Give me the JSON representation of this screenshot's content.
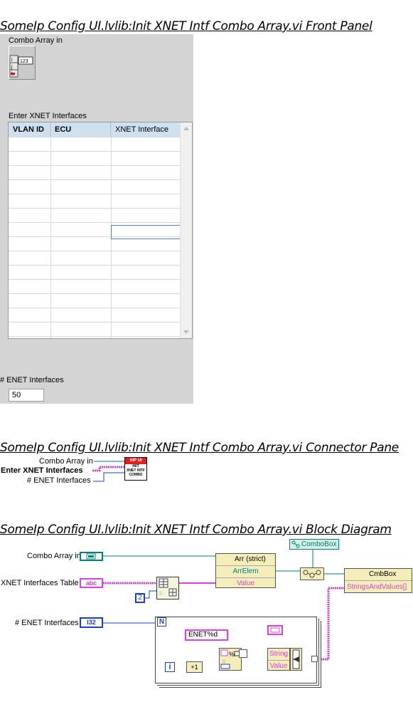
{
  "sections": {
    "front_panel_title": "SomeIp Config UI.lvlib:Init XNET Intf Combo Array.vi Front Panel",
    "connector_title": "SomeIp Config UI.lvlib:Init XNET Intf Combo Array.vi Connector Pane",
    "block_diagram_title": "SomeIp Config UI.lvlib:Init XNET Intf Combo Array.vi Block Diagram"
  },
  "front_panel": {
    "combo_array_label": "Combo Array in",
    "combo_array_icon_text": "123",
    "combo_array_index": "0",
    "table_label": "Enter XNET Interfaces",
    "table_headers": [
      "VLAN ID",
      "ECU",
      "XNET Interface"
    ],
    "enet_label": "# ENET Interfaces",
    "enet_value": "50"
  },
  "connector": {
    "labels": [
      "Combo Array in",
      "Enter XNET Interfaces",
      "# ENET Interfaces"
    ],
    "icon_banner": "SIP UI",
    "icon_lines": [
      "INIT",
      "XNET INTF",
      "COMBO"
    ]
  },
  "block_diagram": {
    "combo_array_label": "Combo Array in",
    "table_label": "XNET Interfaces Table",
    "table_terminal": "abc",
    "enet_label": "# ENET Interfaces",
    "enet_terminal": "I32",
    "const_2": "2",
    "loop_n": "N",
    "loop_i": "i",
    "format_string": "ENET%d",
    "combobox_ref": "ComboBox",
    "bundle_arr": "Arr (strict)",
    "bundle_arrelem": "ArrElem",
    "bundle_value": "Value",
    "cmbbox_node": "CmbBox",
    "cmbbox_prop": "StringsAndValues[]",
    "cluster_string": "String",
    "cluster_value": "Value",
    "increment": "+1",
    "icons": {
      "array_terminal": "array-terminal-icon",
      "index_array": "index-array-icon",
      "format_into_string": "format-into-string-icon",
      "bundle": "bundle-icon",
      "concat_arrays": "build-array-icon"
    },
    "colors": {
      "string_wire": "#e040e0",
      "ref_wire": "#007f7f",
      "int_wire": "#1a3fd6",
      "prop_bg": "#f5eeba",
      "combobox_ref_bg": "#d4f0e4"
    }
  }
}
